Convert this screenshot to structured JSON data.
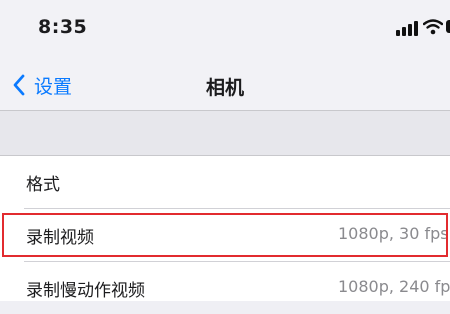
{
  "status_bar": {
    "time": "8:35"
  },
  "nav": {
    "back_label": "设置",
    "title": "相机"
  },
  "settings": {
    "rows": [
      {
        "label": "格式",
        "value": ""
      },
      {
        "label": "录制视频",
        "value": "1080p, 30 fps"
      },
      {
        "label": "录制慢动作视频",
        "value": "1080p, 240 fps"
      }
    ]
  },
  "colors": {
    "accent": "#0a7aff",
    "highlight_border": "#e22b2f"
  },
  "icons": {
    "back": "chevron-left-icon",
    "signal": "cellular-signal-icon",
    "wifi": "wifi-icon",
    "battery": "battery-icon"
  }
}
